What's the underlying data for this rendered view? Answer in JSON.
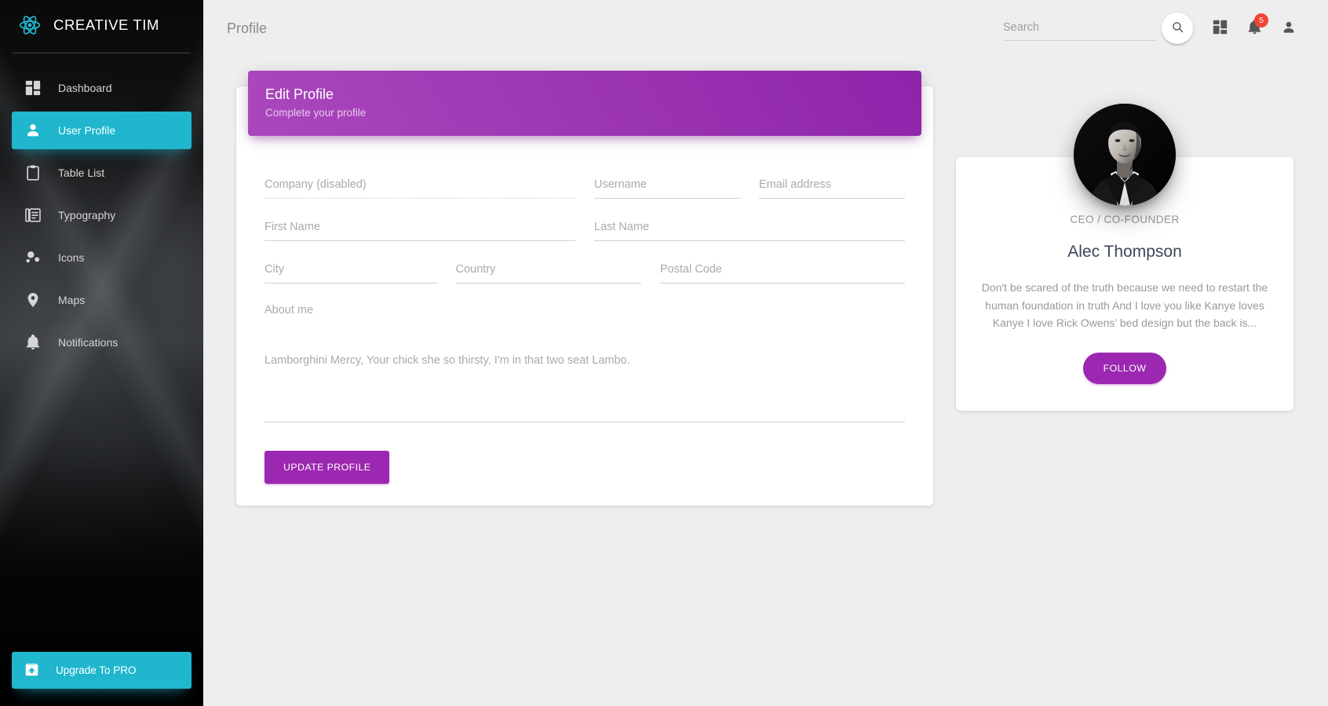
{
  "sidebar": {
    "brand": {
      "title": "CREATIVE TIM",
      "logo_icon": "react-atom-icon"
    },
    "items": [
      {
        "label": "Dashboard",
        "icon": "dashboard-grid-icon",
        "active": false
      },
      {
        "label": "User Profile",
        "icon": "person-icon",
        "active": true
      },
      {
        "label": "Table List",
        "icon": "clipboard-icon",
        "active": false
      },
      {
        "label": "Typography",
        "icon": "text-document-icon",
        "active": false
      },
      {
        "label": "Icons",
        "icon": "bubble-chart-icon",
        "active": false
      },
      {
        "label": "Maps",
        "icon": "location-pin-icon",
        "active": false
      },
      {
        "label": "Notifications",
        "icon": "bell-icon",
        "active": false
      }
    ],
    "upgrade": {
      "label": "Upgrade To PRO",
      "icon": "unarchive-icon"
    },
    "accent_color": "#1fb6ce"
  },
  "topbar": {
    "page_title": "Profile",
    "search": {
      "value": "",
      "placeholder": "Search"
    },
    "search_button_icon": "search-icon",
    "dashboard_icon": "dashboard-grid-icon",
    "notifications_icon": "bell-icon",
    "notifications_count": "5",
    "notifications_badge_color": "#f44336",
    "account_icon": "person-icon"
  },
  "edit_profile_card": {
    "title": "Edit Profile",
    "subtitle": "Complete your profile",
    "header_gradient_from": "#ab47bc",
    "header_gradient_to": "#8e24aa",
    "fields": [
      {
        "label": "Company (disabled)",
        "value": "",
        "disabled": true
      },
      {
        "label": "Username",
        "value": "",
        "disabled": false
      },
      {
        "label": "Email address",
        "value": "",
        "disabled": false
      },
      {
        "label": "First Name",
        "value": "",
        "disabled": false
      },
      {
        "label": "Last Name",
        "value": "",
        "disabled": false
      },
      {
        "label": "City",
        "value": "",
        "disabled": false
      },
      {
        "label": "Country",
        "value": "",
        "disabled": false
      },
      {
        "label": "Postal Code",
        "value": "",
        "disabled": false
      }
    ],
    "about": {
      "label": "About me",
      "value": "Lamborghini Mercy, Your chick she so thirsty, I'm in that two seat Lambo."
    },
    "submit_label": "UPDATE PROFILE",
    "submit_color": "#9c27b0"
  },
  "profile_card": {
    "avatar_icon": "user-portrait-photo",
    "role": "CEO / CO-FOUNDER",
    "name": "Alec Thompson",
    "description": "Don't be scared of the truth because we need to restart the human foundation in truth And I love you like Kanye loves Kanye I love Rick Owens’ bed design but the back is...",
    "follow_label": "FOLLOW",
    "follow_color": "#9c27b0"
  }
}
